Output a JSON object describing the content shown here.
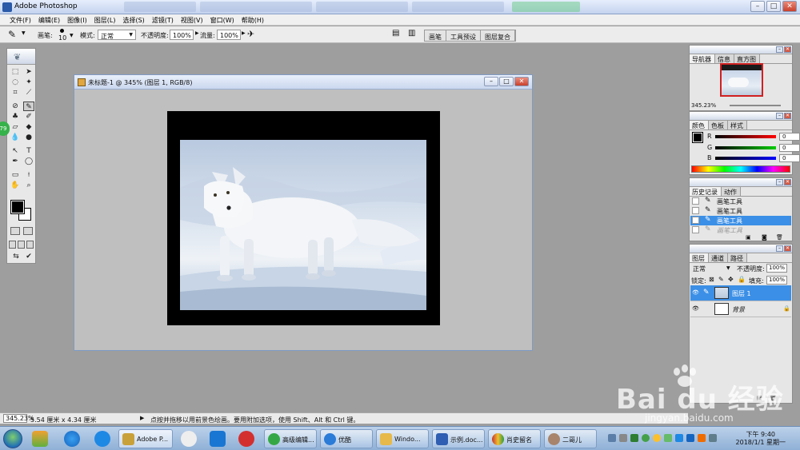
{
  "window": {
    "title": "Adobe Photoshop",
    "min": "–",
    "max": "□",
    "close": "✕"
  },
  "menu": [
    "文件(F)",
    "编辑(E)",
    "图像(I)",
    "图层(L)",
    "选择(S)",
    "滤镜(T)",
    "视图(V)",
    "窗口(W)",
    "帮助(H)"
  ],
  "options": {
    "brush_label": "画笔:",
    "brush_size": "10",
    "mode_label": "模式:",
    "mode_value": "正常",
    "opacity_label": "不透明度:",
    "opacity_value": "100%",
    "flow_label": "流量:",
    "flow_value": "100%"
  },
  "palette_well": [
    "画笔",
    "工具预设",
    "图层复合"
  ],
  "document": {
    "title": "未标题-1 @ 345% (图层 1, RGB/8)"
  },
  "side_badge": "79",
  "navigator": {
    "tabs": [
      "导航器",
      "信息",
      "直方图"
    ],
    "zoom": "345.23%"
  },
  "color": {
    "tabs": [
      "颜色",
      "色板",
      "样式"
    ],
    "channels": [
      {
        "label": "R",
        "value": "0"
      },
      {
        "label": "G",
        "value": "0"
      },
      {
        "label": "B",
        "value": "0"
      }
    ]
  },
  "history": {
    "tabs": [
      "历史记录",
      "动作"
    ],
    "items": [
      {
        "label": "画笔工具",
        "state": "normal"
      },
      {
        "label": "画笔工具",
        "state": "normal"
      },
      {
        "label": "画笔工具",
        "state": "selected"
      },
      {
        "label": "画笔工具",
        "state": "dim"
      }
    ]
  },
  "layers": {
    "tabs": [
      "图层",
      "通道",
      "路径"
    ],
    "blend_mode": "正常",
    "opacity_label": "不透明度:",
    "opacity_value": "100%",
    "lock_label": "锁定:",
    "fill_label": "填充:",
    "fill_value": "100%",
    "items": [
      {
        "name": "图层 1",
        "selected": true
      },
      {
        "name": "背景",
        "selected": false
      }
    ]
  },
  "status": {
    "zoom": "345.23%",
    "size": "5.54 厘米 x 4.34 厘米",
    "hint": "点按并拖移以用前景色绘画。要用附加选项，使用 Shift、Alt 和 Ctrl 键。"
  },
  "taskbar": {
    "tasks": [
      {
        "label": "Adobe P...",
        "color": "#c9a13a",
        "active": true
      },
      {
        "label": "高级编辑...",
        "color": "#35a845",
        "active": false
      },
      {
        "label": "优酷",
        "color": "#2b7bd8",
        "active": false
      },
      {
        "label": "Windo...",
        "color": "#e6b94a",
        "active": false
      },
      {
        "label": "示例.doc...",
        "color": "#2f5eb2",
        "active": false
      },
      {
        "label": "肖史留名",
        "color": "#c8362c",
        "active": false
      },
      {
        "label": "二哥儿",
        "color": "#a7846b",
        "active": false
      }
    ],
    "time": "下午 9:40",
    "date": "2018/1/1 星期一"
  },
  "watermark": {
    "brand": "Bai du 经验",
    "url": "jingyan.baidu.com"
  },
  "colors": {
    "selection": "#3b8fe6",
    "canvas_border": "#000000"
  }
}
